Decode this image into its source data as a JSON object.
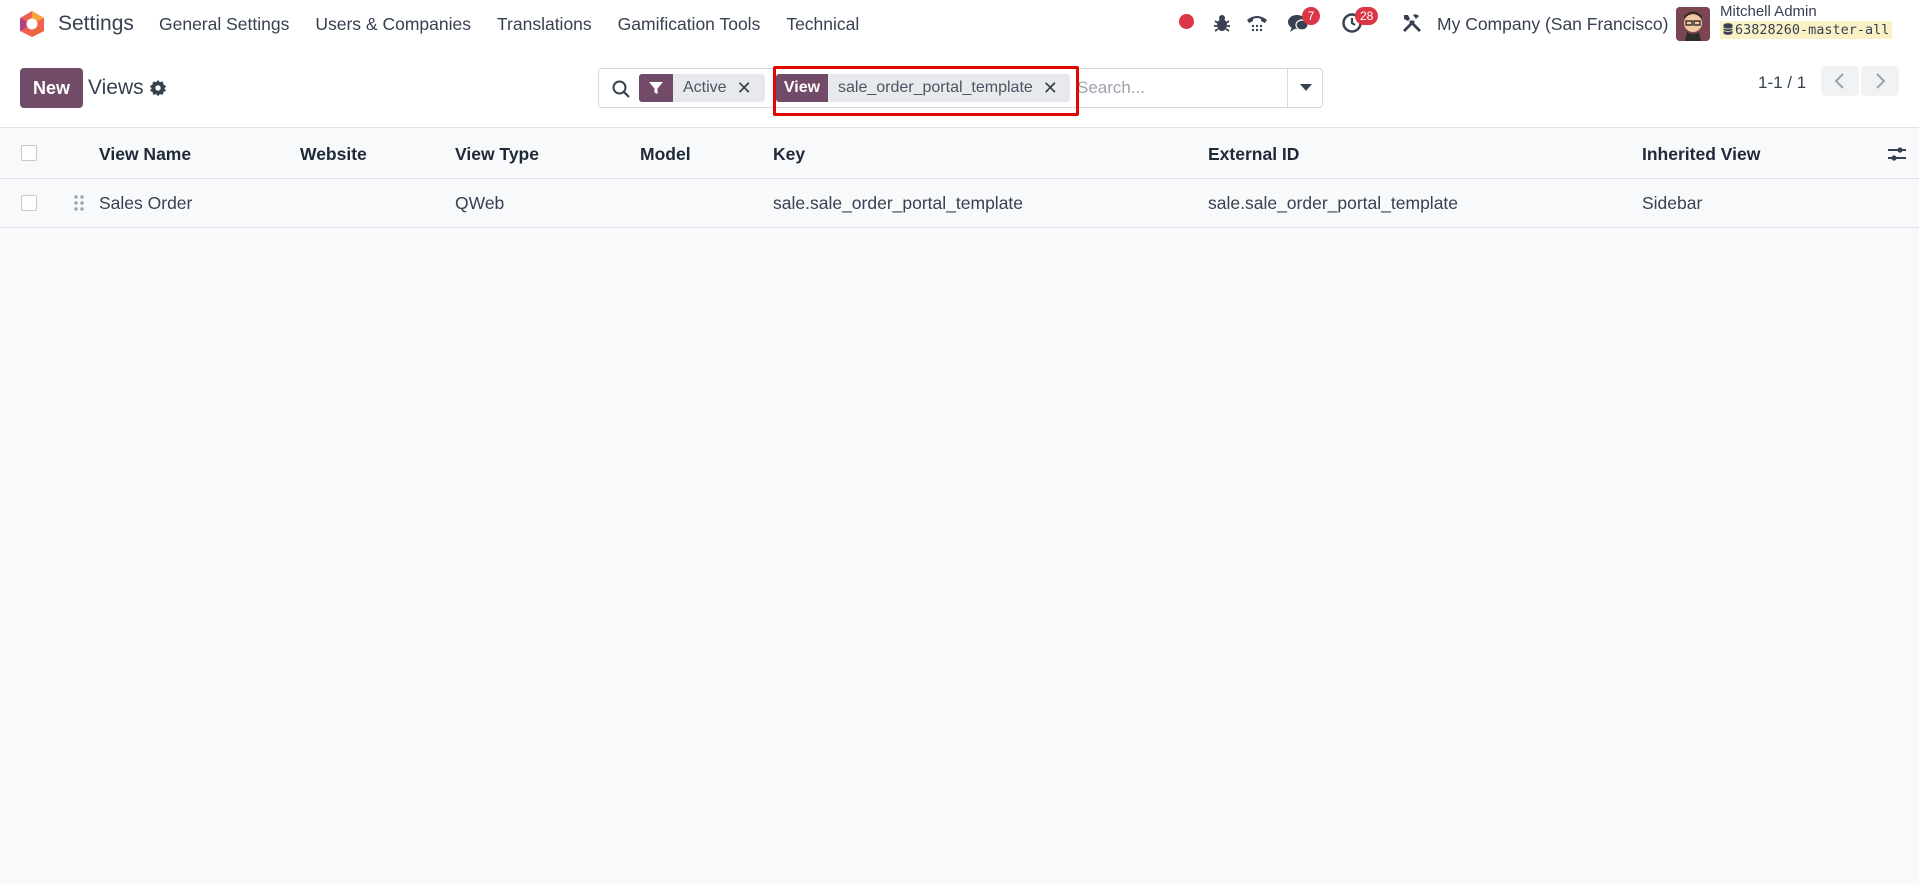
{
  "navbar": {
    "app_name": "Settings",
    "menu": [
      "General Settings",
      "Users & Companies",
      "Translations",
      "Gamification Tools",
      "Technical"
    ],
    "messages_badge": "7",
    "activities_badge": "28",
    "company": "My Company (San Francisco)",
    "user_name": "Mitchell Admin",
    "database": "63828260-master-all",
    "icons": [
      "record-dot-icon",
      "bug-icon",
      "phone-icon",
      "chat-icon",
      "clock-icon",
      "tools-icon"
    ]
  },
  "control_panel": {
    "new_label": "New",
    "breadcrumb": "Views",
    "search": {
      "facets": [
        {
          "label_icon": "filter-icon",
          "value": "Active"
        },
        {
          "label": "View",
          "value": "sale_order_portal_template"
        }
      ],
      "placeholder": "Search..."
    },
    "pager": "1-1 / 1"
  },
  "list": {
    "columns": [
      "View Name",
      "Website",
      "View Type",
      "Model",
      "Key",
      "External ID",
      "Inherited View"
    ],
    "rows": [
      {
        "view_name": "Sales Order",
        "website": "",
        "view_type": "QWeb",
        "model": "",
        "key": "sale.sale_order_portal_template",
        "external_id": "sale.sale_order_portal_template",
        "inherited_view": "Sidebar"
      }
    ]
  },
  "colors": {
    "primary": "#714b67",
    "badge": "#dc3545",
    "highlight": "#e10600",
    "background": "#f8f9fa"
  }
}
